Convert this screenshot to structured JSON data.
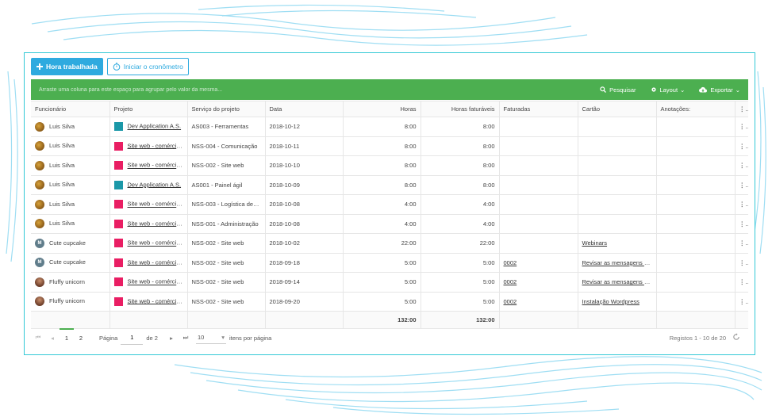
{
  "toolbar": {
    "hour_button": "Hora trabalhada",
    "timer_button": "Iniciar o cronômetro"
  },
  "groupbar": {
    "hint": "Arraste uma coluna para este espaço para agrupar pelo valor da mesma...",
    "search": "Pesquisar",
    "layout": "Layout",
    "export": "Exportar"
  },
  "columns": [
    "Funcionário",
    "Projeto",
    "Serviço do projeto",
    "Data",
    "Horas",
    "Horas faturáveis",
    "Faturadas",
    "Cartão",
    "Anotações:"
  ],
  "rows": [
    {
      "employee": "Luis Silva",
      "avatar": "brown",
      "project": "Dev Application A.S.",
      "project_color": "#1b98a8",
      "service": "AS003 - Ferramentas",
      "date": "2018-10-12",
      "hours": "8:00",
      "billable": "8:00",
      "invoiced": "",
      "card": "",
      "notes": ""
    },
    {
      "employee": "Luis Silva",
      "avatar": "brown",
      "project": "Site web - comércio ...",
      "project_color": "#e91e63",
      "service": "NSS-004 - Comunicação",
      "date": "2018-10-11",
      "hours": "8:00",
      "billable": "8:00",
      "invoiced": "",
      "card": "",
      "notes": ""
    },
    {
      "employee": "Luis Silva",
      "avatar": "brown",
      "project": "Site web - comércio ...",
      "project_color": "#e91e63",
      "service": "NSS-002 - Site web",
      "date": "2018-10-10",
      "hours": "8:00",
      "billable": "8:00",
      "invoiced": "",
      "card": "",
      "notes": ""
    },
    {
      "employee": "Luis Silva",
      "avatar": "brown",
      "project": "Dev Application A.S.",
      "project_color": "#1b98a8",
      "service": "AS001 - Painel ágil",
      "date": "2018-10-09",
      "hours": "8:00",
      "billable": "8:00",
      "invoiced": "",
      "card": "",
      "notes": ""
    },
    {
      "employee": "Luis Silva",
      "avatar": "brown",
      "project": "Site web - comércio ...",
      "project_color": "#e91e63",
      "service": "NSS-003 - Logística de ev...",
      "date": "2018-10-08",
      "hours": "4:00",
      "billable": "4:00",
      "invoiced": "",
      "card": "",
      "notes": ""
    },
    {
      "employee": "Luis Silva",
      "avatar": "brown",
      "project": "Site web - comércio ...",
      "project_color": "#e91e63",
      "service": "NSS-001 - Administração",
      "date": "2018-10-08",
      "hours": "4:00",
      "billable": "4:00",
      "invoiced": "",
      "card": "",
      "notes": ""
    },
    {
      "employee": "Cute cupcake",
      "avatar": "M",
      "project": "Site web - comércio ...",
      "project_color": "#e91e63",
      "service": "NSS-002 - Site web",
      "date": "2018-10-02",
      "hours": "22:00",
      "billable": "22:00",
      "invoiced": "",
      "card": "Webinars",
      "notes": ""
    },
    {
      "employee": "Cute cupcake",
      "avatar": "M",
      "project": "Site web - comércio ...",
      "project_color": "#e91e63",
      "service": "NSS-002 - Site web",
      "date": "2018-09-18",
      "hours": "5:00",
      "billable": "5:00",
      "invoiced": "0002",
      "card": "Revisar as mensagens aut...",
      "notes": ""
    },
    {
      "employee": "Fluffy unicorn",
      "avatar": "person",
      "project": "Site web - comércio ...",
      "project_color": "#e91e63",
      "service": "NSS-002 - Site web",
      "date": "2018-09-14",
      "hours": "5:00",
      "billable": "5:00",
      "invoiced": "0002",
      "card": "Revisar as mensagens aut...",
      "notes": ""
    },
    {
      "employee": "Fluffy unicorn",
      "avatar": "person",
      "project": "Site web - comércio ...",
      "project_color": "#e91e63",
      "service": "NSS-002 - Site web",
      "date": "2018-09-20",
      "hours": "5:00",
      "billable": "5:00",
      "invoiced": "0002",
      "card": "Instalação Wordpress",
      "notes": ""
    }
  ],
  "totals": {
    "hours": "132:00",
    "billable": "132:00"
  },
  "pager": {
    "pages": [
      "1",
      "2"
    ],
    "page_label": "Página",
    "current_page": "1",
    "of_label": "de 2",
    "per_page": "10",
    "per_page_label": "itens por página",
    "records": "Registos 1 - 10 de 20"
  },
  "colors": {
    "accent": "#2eaadf",
    "green": "#4caf50",
    "frame": "#33c9d6"
  }
}
